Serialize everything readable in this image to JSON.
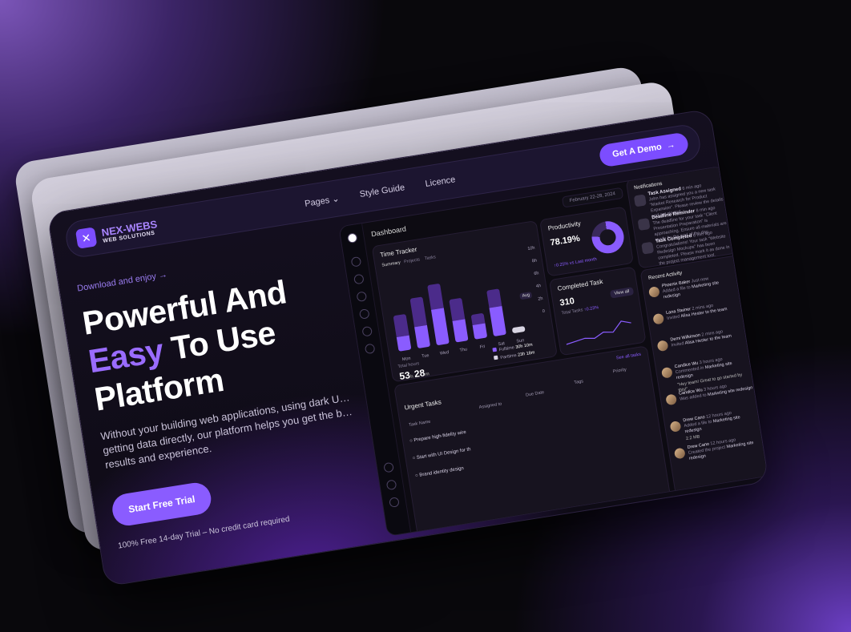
{
  "nav": {
    "brand": "NEX-WEBS",
    "brand_sub": "WEB SOLUTIONS",
    "links": [
      "Pages",
      "Style Guide",
      "Licence"
    ],
    "cta": "Get A Demo"
  },
  "hero": {
    "download": "Download and enjoy",
    "title_line1": "Powerful And",
    "title_accent": "Easy",
    "title_line2": "To Use",
    "title_line3": "Platform",
    "subtitle": "Without your building web applications, using dark U… getting data directly, our platform helps you get the b… results and experience.",
    "trial_button": "Start Free Trial",
    "trial_note": "100% Free 14-day Trial – No credit card required"
  },
  "dashboard": {
    "title": "Dashboard",
    "date_range": "February 22-28, 2024",
    "time_tracker": {
      "title": "Time Tracker",
      "tabs": [
        "Summary",
        "Projects",
        "Tasks"
      ],
      "y_ticks": [
        "10h",
        "8h",
        "6h",
        "4h",
        "2h",
        "0"
      ],
      "avg_label": "Avg",
      "days": [
        "Mon",
        "Tue",
        "Wed",
        "Thu",
        "Fri",
        "Sat",
        "Sun"
      ],
      "total_label": "Total hours",
      "total_hours": "53",
      "total_minutes": "28",
      "legend": [
        {
          "label": "Fulltime",
          "value": "30h 10m"
        },
        {
          "label": "Parttime",
          "value": "23h 18m"
        }
      ]
    },
    "productivity": {
      "title": "Productivity",
      "value": "78.19%",
      "note": "↑0.25% vs Last month"
    },
    "completed": {
      "title": "Completed Task",
      "value": "310",
      "label": "Total Tasks",
      "trend": "↑0.23%",
      "view_all": "View all"
    },
    "urgent": {
      "title": "Urgent Tasks",
      "see_all": "See all tasks",
      "columns": [
        "Task Name",
        "Assigned to",
        "Due Date",
        "Tags",
        "Priority"
      ],
      "rows": [
        "Prepare high-fidelity wire",
        "Start with UI Design for th",
        "Brand identity design"
      ]
    },
    "notifications": {
      "title": "Notifications",
      "items": [
        {
          "title": "Task Assigned",
          "time": "6 min ago",
          "text": "John has assigned you a new task \"Market Research for Product Expansion\". Please review the details and get started."
        },
        {
          "title": "Deadline Reminder",
          "time": "8 min ago",
          "text": "The deadline for your task \"Client Presentation Preparation\" is approaching. Ensure all materials are ready by the end of the day."
        },
        {
          "title": "Task Completed",
          "time": "6 min ago",
          "text": "Congratulations! Your task \"Website Redesign Mockups\" has been completed. Please mark it as done in the project management tool."
        }
      ]
    },
    "activity": {
      "title": "Recent Activity",
      "items": [
        {
          "name": "Phoenix Baker",
          "time": "Just now",
          "text": "Added a file to",
          "target": "Marketing site redesign"
        },
        {
          "name": "Lana Steiner",
          "time": "2 mins ago",
          "text": "Invited",
          "target": "Alisa Hester to the team"
        },
        {
          "name": "Demi Wilkinson",
          "time": "2 mins ago",
          "text": "Invited",
          "target": "Alisa Hester to the team"
        },
        {
          "name": "Candice Wu",
          "time": "3 hours ago",
          "text": "Commented in",
          "target": "Marketing site redesign"
        },
        {
          "name": "Candice Wu",
          "time": "3 hours ago",
          "text": "Was added to",
          "target": "Marketing site redesign"
        },
        {
          "name": "Drew Cano",
          "time": "12 hours ago",
          "text": "Added a file to",
          "target": "Marketing site redesign"
        },
        {
          "name": "Drew Cano",
          "time": "12 hours ago",
          "text": "Created the project",
          "target": "Marketing site redesign"
        }
      ],
      "quote": "\"Hey team! Great to go started by this!\"",
      "file_size": "2.2 MB"
    }
  },
  "chart_data": {
    "type": "bar",
    "title": "Time Tracker",
    "categories": [
      "Mon",
      "Tue",
      "Wed",
      "Thu",
      "Fri",
      "Sat",
      "Sun"
    ],
    "series": [
      {
        "name": "Fulltime",
        "values": [
          2,
          3,
          5,
          3,
          2,
          4,
          0.8
        ]
      },
      {
        "name": "Parttime",
        "values": [
          3,
          4,
          3.5,
          3,
          1.5,
          2.5,
          0
        ]
      }
    ],
    "ylim": [
      0,
      10
    ]
  },
  "colors": {
    "accent": "#8a5cff",
    "accent_dark": "#4b2b8a",
    "bg": "#0e0b15"
  }
}
